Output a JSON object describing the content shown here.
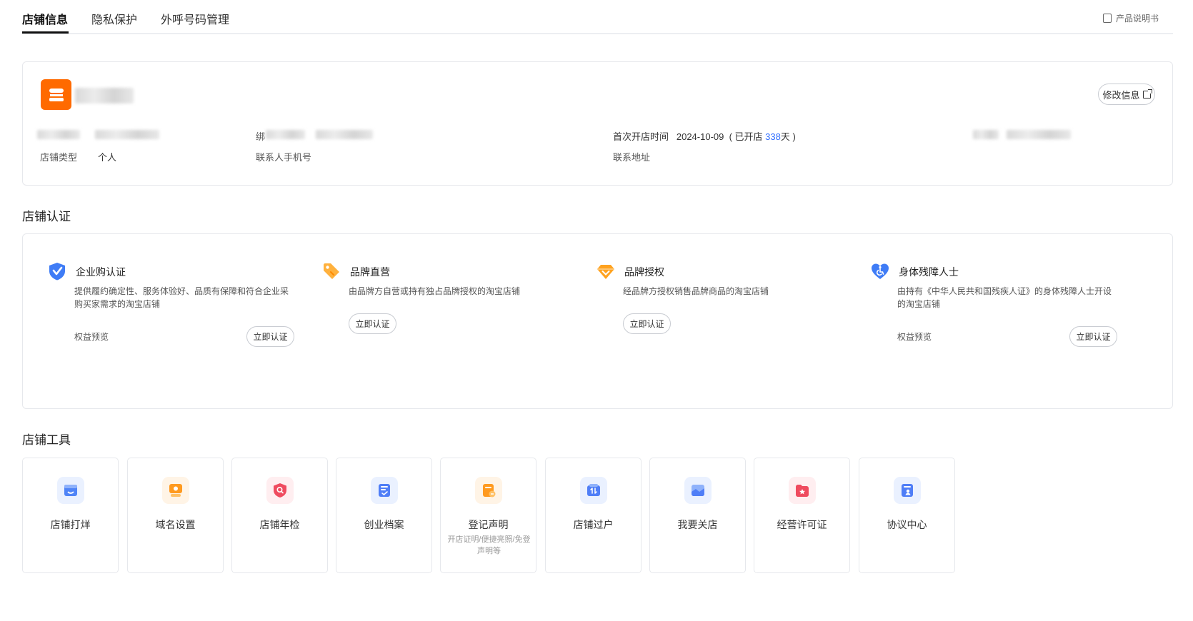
{
  "tabs": [
    {
      "label": "店铺信息",
      "active": true
    },
    {
      "label": "隐私保护",
      "active": false
    },
    {
      "label": "外呼号码管理",
      "active": false
    }
  ],
  "manual_label": "产品说明书",
  "store_info": {
    "edit_button": "修改信息",
    "first_open_label": "首次开店时间",
    "first_open_date": "2024-10-09",
    "open_days_prefix": "( 已开店 ",
    "open_days": "338",
    "open_days_suffix": "天 )",
    "contact_prefix_visible": "绑",
    "store_type_label": "店铺类型",
    "store_type_value": "个人",
    "contact_phone_label": "联系人手机号",
    "contact_address_label": "联系地址"
  },
  "certification": {
    "section_title": "店铺认证",
    "items": [
      {
        "icon": "shield-check-icon",
        "title": "企业购认证",
        "desc": "提供履约确定性、服务体验好、品质有保障和符合企业采购买家需求的淘宝店铺",
        "link": "权益预览",
        "button": "立即认证"
      },
      {
        "icon": "brand-tag-icon",
        "title": "品牌直营",
        "desc": "由品牌方自营或持有独占品牌授权的淘宝店铺",
        "link": "",
        "button": "立即认证"
      },
      {
        "icon": "diamond-icon",
        "title": "品牌授权",
        "desc": "经品牌方授权销售品牌商品的淘宝店铺",
        "link": "",
        "button": "立即认证"
      },
      {
        "icon": "accessibility-heart-icon",
        "title": "身体残障人士",
        "desc": "由持有《中华人民共和国残疾人证》的身体残障人士开设的淘宝店铺",
        "link": "权益预览",
        "button": "立即认证"
      }
    ]
  },
  "tools": {
    "section_title": "店铺工具",
    "items": [
      {
        "label": "店铺打烊",
        "sub": "",
        "icon": "store-close-icon",
        "color": "#3f7cf6"
      },
      {
        "label": "域名设置",
        "sub": "",
        "icon": "domain-icon",
        "color": "#ff9a1f"
      },
      {
        "label": "店铺年检",
        "sub": "",
        "icon": "shield-search-icon",
        "color": "#ef4b5f"
      },
      {
        "label": "创业档案",
        "sub": "",
        "icon": "archive-check-icon",
        "color": "#4f7ef7"
      },
      {
        "label": "登记声明",
        "sub": "开店证明/便捷亮照/免登声明等",
        "icon": "register-doc-icon",
        "color": "#ff9a1f"
      },
      {
        "label": "店铺过户",
        "sub": "",
        "icon": "transfer-icon",
        "color": "#4f7ef7"
      },
      {
        "label": "我要关店",
        "sub": "",
        "icon": "shop-exit-icon",
        "color": "#4f7ef7"
      },
      {
        "label": "经营许可证",
        "sub": "",
        "icon": "license-icon",
        "color": "#ef4b5f"
      },
      {
        "label": "协议中心",
        "sub": "",
        "icon": "agreement-icon",
        "color": "#4f7ef7"
      }
    ]
  }
}
